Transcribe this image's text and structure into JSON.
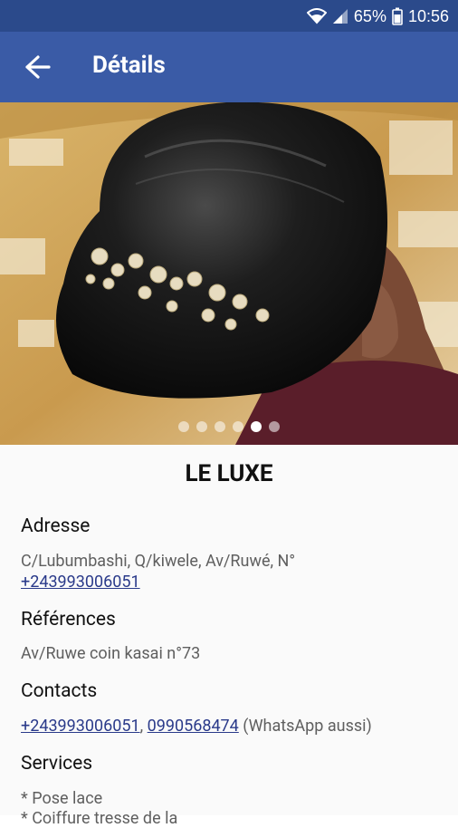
{
  "status_bar": {
    "battery": "65%",
    "time": "10:56"
  },
  "app_bar": {
    "title": "Détails"
  },
  "carousel": {
    "dot_count": 6,
    "active_index": 4
  },
  "shop": {
    "name": "LE LUXE"
  },
  "address": {
    "label": "Adresse",
    "line": "C/Lubumbashi, Q/kiwele, Av/Ruwé, N°",
    "phone": "+243993006051"
  },
  "references": {
    "label": "Références",
    "text": "Av/Ruwe coin kasai n°73"
  },
  "contacts": {
    "label": "Contacts",
    "phone1": "+243993006051",
    "separator": ", ",
    "phone2": "0990568474",
    "note": " (WhatsApp aussi)"
  },
  "services": {
    "label": "Services",
    "item1": "* Pose lace",
    "item2": "* Coiffure tresse de la"
  },
  "colors": {
    "status_bar": "#2b4a8b",
    "app_bar": "#3a5ba6",
    "link": "#2a3a8a"
  }
}
